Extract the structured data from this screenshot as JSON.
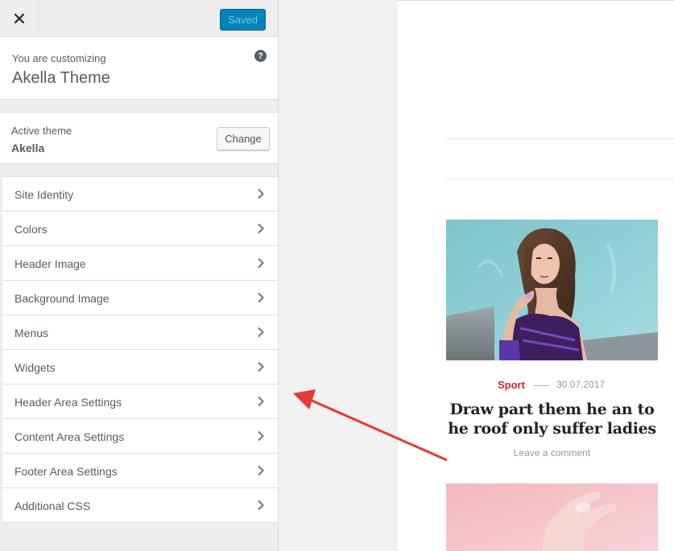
{
  "customizer": {
    "close_icon": "close-icon",
    "save_label": "Saved",
    "pre_title": "You are customizing",
    "theme_title": "Akella Theme",
    "help_glyph": "?",
    "active_theme_label": "Active theme",
    "active_theme_name": "Akella",
    "change_label": "Change",
    "sections": [
      {
        "label": "Site Identity"
      },
      {
        "label": "Colors"
      },
      {
        "label": "Header Image"
      },
      {
        "label": "Background Image"
      },
      {
        "label": "Menus"
      },
      {
        "label": "Widgets"
      },
      {
        "label": "Header Area Settings"
      },
      {
        "label": "Content Area Settings"
      },
      {
        "label": "Footer Area Settings"
      },
      {
        "label": "Additional CSS"
      }
    ]
  },
  "preview": {
    "post": {
      "category": "Sport",
      "date": "30.07.2017",
      "title": "Draw part them he an to he roof only suffer ladies",
      "comment_link": "Leave a comment"
    }
  },
  "colors": {
    "primary_button": "#0085ba",
    "category_accent": "#d3243a",
    "annotation_arrow": "#e53935"
  }
}
